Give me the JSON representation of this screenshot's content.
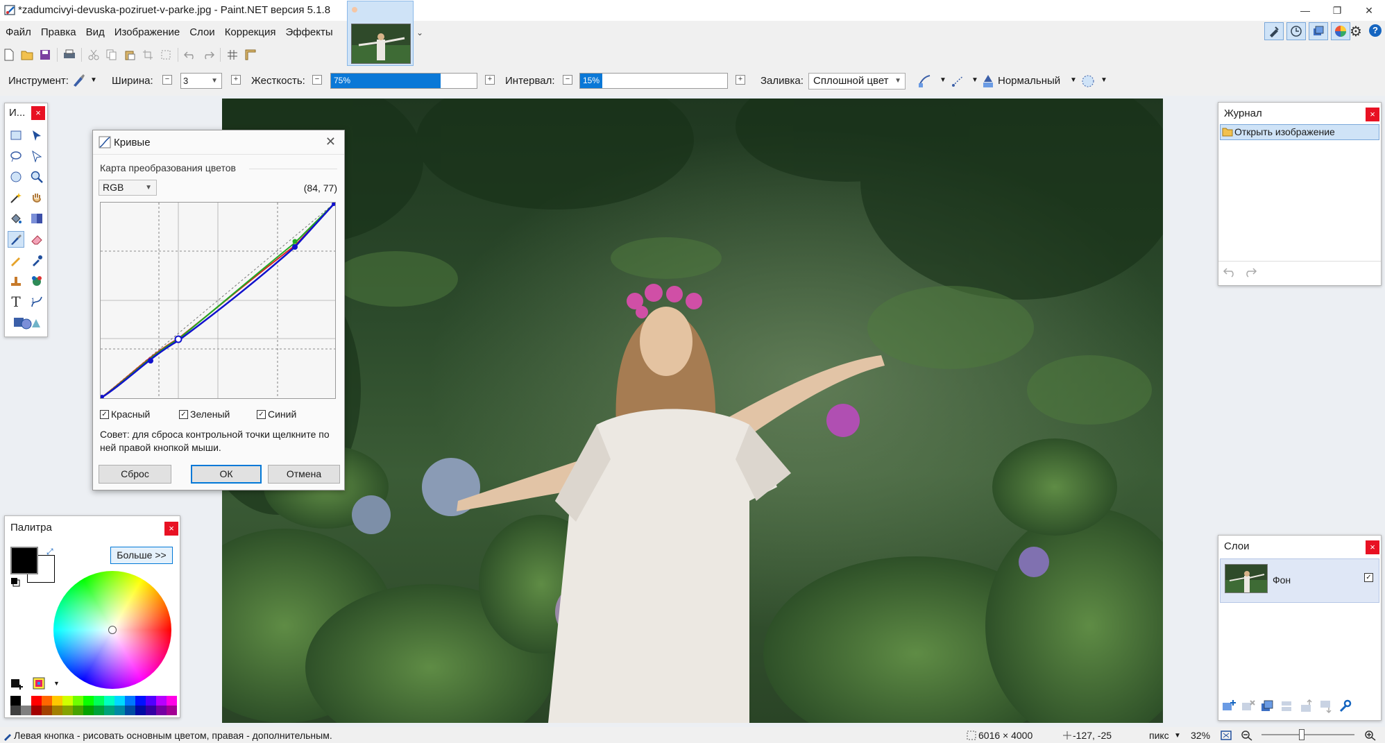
{
  "window": {
    "title": "*zadumcivyi-devuska-poziruet-v-parke.jpg - Paint.NET версия 5.1.8"
  },
  "menu": [
    "Файл",
    "Правка",
    "Вид",
    "Изображение",
    "Слои",
    "Коррекция",
    "Эффекты"
  ],
  "toolbar": {
    "tool_label": "Инструмент:",
    "width_label": "Ширина:",
    "width_value": "3",
    "hardness_label": "Жесткость:",
    "hardness_value": "75%",
    "hardness_fraction": 0.75,
    "interval_label": "Интервал:",
    "interval_value": "15%",
    "interval_fraction": 0.15,
    "fill_label": "Заливка:",
    "fill_value": "Сплошной цвет",
    "blend_value": "Нормальный"
  },
  "tools_panel": {
    "title": "И..."
  },
  "curves": {
    "title": "Кривые",
    "group_label": "Карта преобразования цветов",
    "mode": "RGB",
    "coords": "(84, 77)",
    "checks": [
      {
        "label": "Красный",
        "checked": true
      },
      {
        "label": "Зеленый",
        "checked": true
      },
      {
        "label": "Синий",
        "checked": true
      }
    ],
    "hint": "Совет: для сброса контрольной точки щелкните по ней правой кнопкой мыши.",
    "buttons": {
      "reset": "Сброс",
      "ok": "ОК",
      "cancel": "Отмена"
    }
  },
  "palette": {
    "title": "Палитра",
    "more_button": "Больше >>",
    "primary_color": "#000000",
    "secondary_color": "#ffffff"
  },
  "history": {
    "title": "Журнал",
    "items": [
      "Открыть изображение"
    ]
  },
  "layers": {
    "title": "Слои",
    "items": [
      {
        "name": "Фон",
        "visible": true
      }
    ]
  },
  "status": {
    "hint": "Левая кнопка - рисовать основным цветом, правая - дополнительным.",
    "image_size": "6016 × 4000",
    "cursor_pos": "-127, -25",
    "units": "пикс",
    "zoom": "32%"
  },
  "colors": {
    "accent": "#0078d7",
    "selection": "#cfe3f7",
    "close": "#e81123"
  }
}
